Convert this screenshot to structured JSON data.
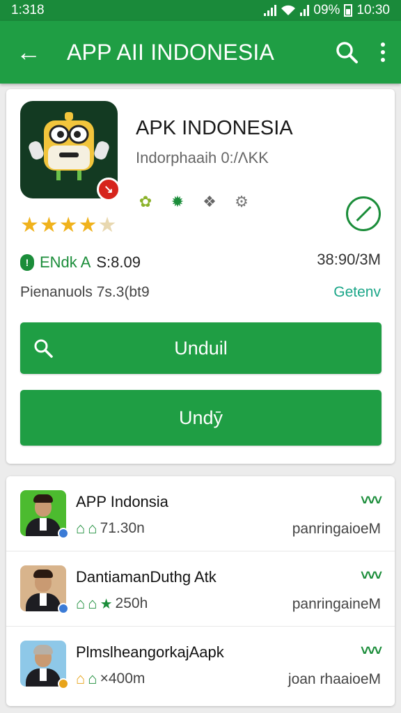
{
  "status": {
    "time": "1:318",
    "battery": "09%",
    "clock": "10:30"
  },
  "appbar": {
    "title": "APP AII INDONESIA",
    "back_icon": "arrow-back-icon",
    "search_icon": "search-icon",
    "menu_icon": "more-vert-icon"
  },
  "app": {
    "name": "APK INDONESIA",
    "subtitle": "Indorphaaih 0:/ΛKK",
    "icon_badge": "↘",
    "rating_stars": 4.5,
    "download_label": "ENdk A",
    "download_value": "S:8.09",
    "size": "38:90/3M",
    "meta": "Pienanuols 7s.3(bt9",
    "more_link": "Getenv",
    "badges": [
      "leaf-icon",
      "gear-star-icon",
      "award-icon",
      "settings-icon"
    ],
    "colors": {
      "primary": "#1f9e44",
      "dark": "#1a8a3a",
      "star": "#f0b21c",
      "accent": "#1ba688"
    }
  },
  "buttons": {
    "primary": "Unduil",
    "secondary": "Undӯ"
  },
  "list": [
    {
      "name": "APP Indonsia",
      "meta": "71.30n",
      "right": "panringaioeM",
      "chevron": "˅˅˅"
    },
    {
      "name": "DantiamanDuthg Atk",
      "meta": "250h",
      "right": "panringaineM",
      "chevron": "˅˅˅"
    },
    {
      "name": "PlmslheangorkajAapk",
      "meta": "×400m",
      "right": "joan rhaaioeM",
      "chevron": "˅˅˅"
    }
  ]
}
